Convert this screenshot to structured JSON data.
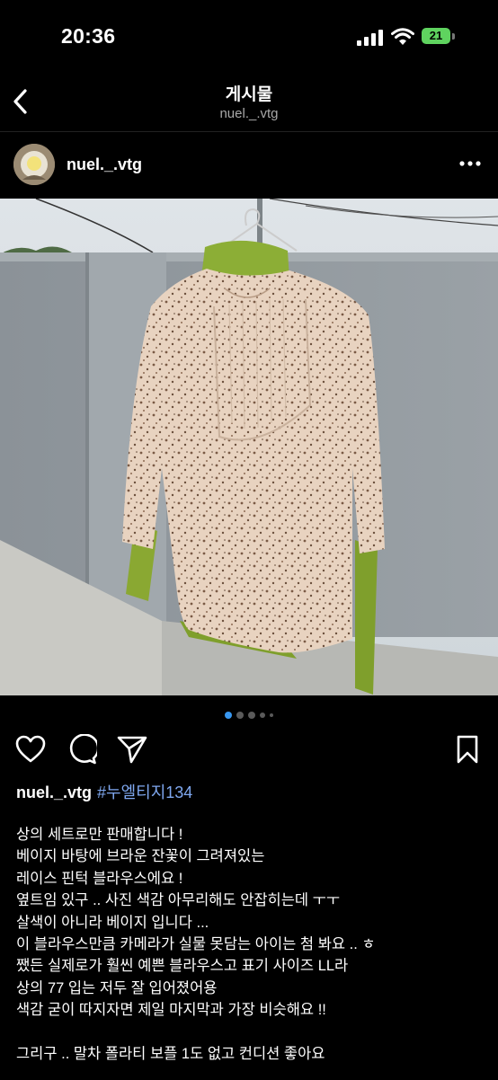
{
  "status_bar": {
    "time": "20:36",
    "battery": "21",
    "icons": [
      "cellular-signal-icon",
      "wifi-icon",
      "battery-icon"
    ]
  },
  "header": {
    "title": "게시물",
    "subtitle": "nuel._.vtg",
    "back_icon": "chevron-left-icon"
  },
  "post": {
    "username": "nuel._.vtg",
    "more_icon": "ellipsis-icon",
    "image_description_icon": "photo",
    "carousel": {
      "count": 5,
      "active_index": 0
    },
    "actions": [
      "heart-icon",
      "comment-icon",
      "send-icon",
      "bookmark-icon"
    ],
    "caption": {
      "username": "nuel._.vtg",
      "hashtag": "#누엘티지134",
      "lines": [
        "상의 세트로만 판매합니다 !",
        "베이지 바탕에 브라운 잔꽃이 그려져있는",
        "레이스 핀턱 블라우스에요 !",
        "옆트임 있구 .. 사진 색감 아무리해도 안잡히는데 ㅜㅜ",
        "살색이 아니라 베이지 입니다 ...",
        "이 블라우스만큼 카메라가 실물 못담는 아이는 첨 봐요 .. ㅎ",
        "쨌든 실제로가 훨씬 예쁜 블라우스고 표기 사이즈 LL라",
        "상의 77 입는 저두 잘 입어졌어용",
        "색감 굳이 따지자면 제일 마지막과 가장 비슷해요 !!",
        "",
        "그리구 .. 말차 폴라티 보플 1도 없고 컨디션 좋아요"
      ]
    }
  },
  "colors": {
    "background": "#000000",
    "accent": "#3897f0",
    "hashtag": "#7fa8f0",
    "battery": "#5fd35f"
  }
}
